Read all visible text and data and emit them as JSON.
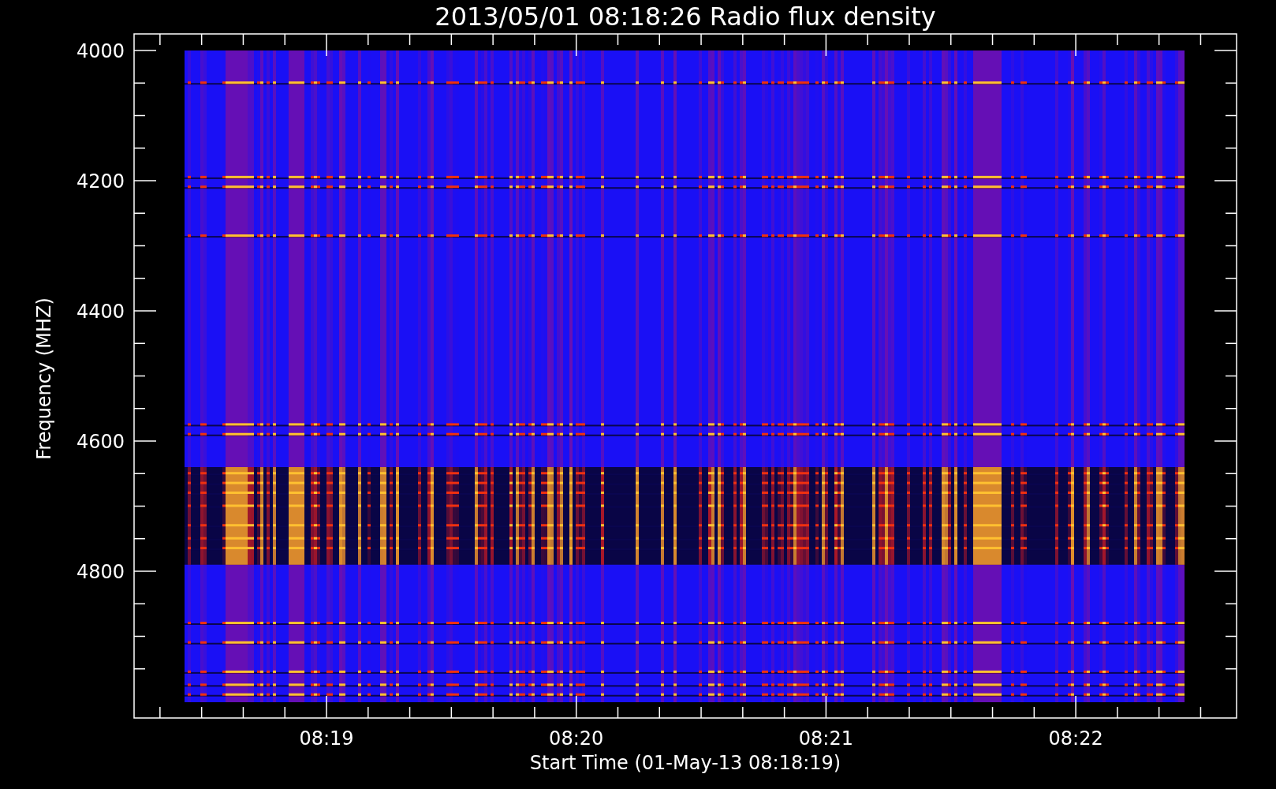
{
  "title": "2013/05/01 08:18:26 Radio flux density",
  "ylabel": "Frequency (MHZ)",
  "xlabel": "Start Time (01-May-13 08:18:19)",
  "yticks": [
    "4000",
    "4200",
    "4400",
    "4600",
    "4800"
  ],
  "xticks": [
    "08:19",
    "08:20",
    "08:21",
    "08:22"
  ]
}
